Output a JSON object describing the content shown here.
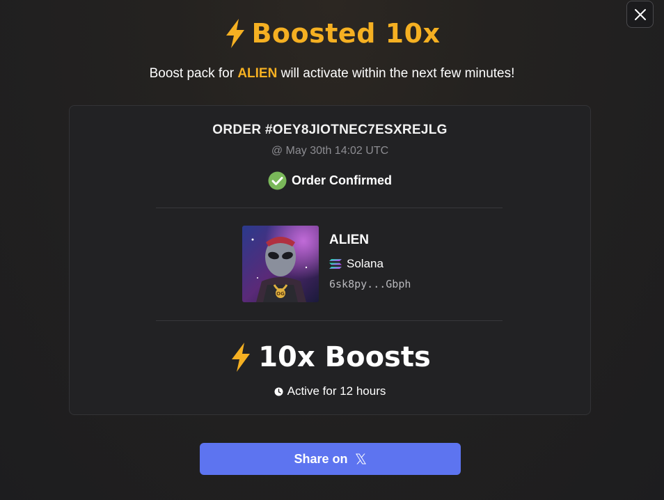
{
  "dialog": {
    "close_icon": "close-icon",
    "title": "Boosted 10x",
    "title_icon": "lightning-bolt-icon",
    "subtitle_prefix": "Boost pack for ",
    "subtitle_token": "ALIEN",
    "subtitle_suffix": " will activate within the next few minutes!"
  },
  "order": {
    "id_label": "ORDER #OEY8JIOTNEC7ESXREJLG",
    "timestamp": "@ May 30th 14:02 UTC",
    "status": "Order Confirmed",
    "status_icon": "check-circle-icon"
  },
  "token": {
    "name": "ALIEN",
    "image": "alien-token-avatar",
    "chain": "Solana",
    "chain_icon": "solana-icon",
    "address": "6sk8py...Gbph"
  },
  "boost": {
    "label": "10x Boosts",
    "icon": "lightning-bolt-icon",
    "duration": "Active for 12 hours",
    "duration_icon": "clock-icon"
  },
  "share": {
    "label": "Share on",
    "icon": "x-logo-icon"
  },
  "colors": {
    "accent": "#f5b022",
    "share_button": "#5d74f0",
    "success": "#7ab85a"
  }
}
